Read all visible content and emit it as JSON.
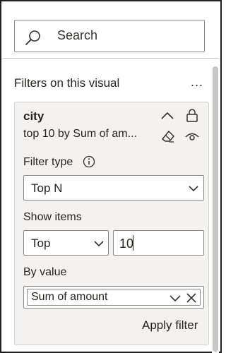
{
  "search": {
    "placeholder": "Search",
    "icon": "search-icon"
  },
  "filters": {
    "title": "Filters on this visual",
    "more_label": "..."
  },
  "card": {
    "field": "city",
    "summary": "top 10 by Sum of am...",
    "icons": [
      "chevron-up-icon",
      "lock-icon",
      "eraser-icon",
      "eye-icon"
    ],
    "filter_type_label": "Filter type",
    "filter_type_value": "Top N",
    "show_items_label": "Show items",
    "show_items_direction": "Top",
    "show_items_count": "10",
    "by_value_label": "By value",
    "by_value_field": "Sum of amount",
    "apply_label": "Apply filter"
  },
  "colors": {
    "card_bg": "#f3f2f1",
    "border": "#8a8886",
    "text": "#252423"
  }
}
